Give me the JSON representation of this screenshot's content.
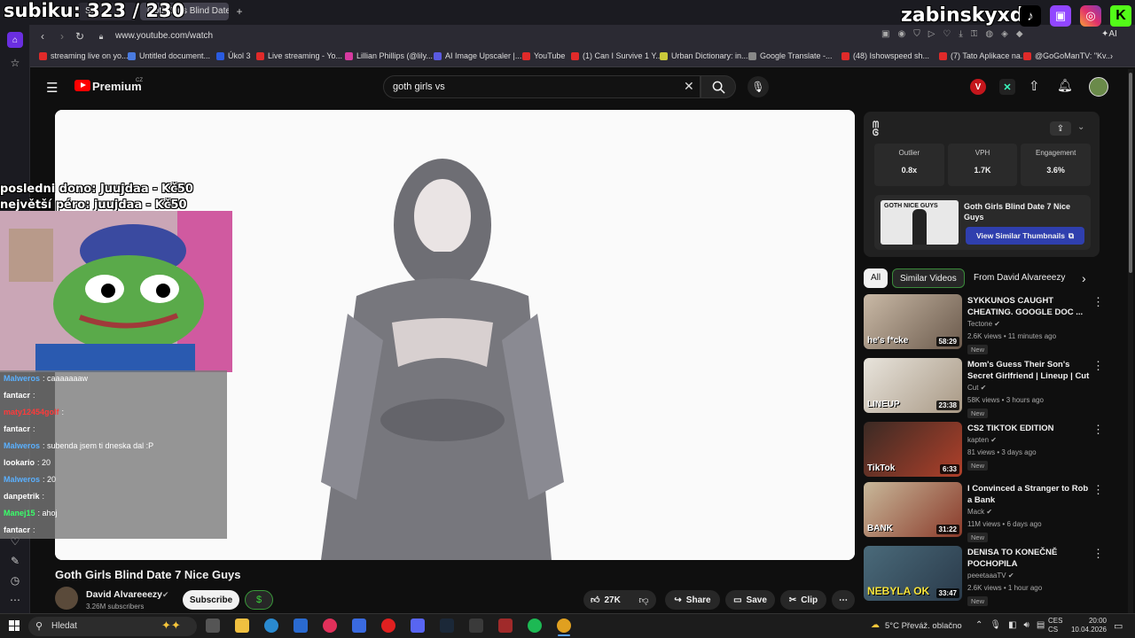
{
  "browser": {
    "tabs": [
      "S...",
      "Goth Girls Blind Date 7 N..."
    ],
    "url": "www.youtube.com/watch",
    "bookmarks": [
      {
        "label": "streaming live on yo...",
        "color": "#e02a2a"
      },
      {
        "label": "Untitled document...",
        "color": "#4a7be0"
      },
      {
        "label": "Úkol 3",
        "color": "#2a5be0"
      },
      {
        "label": "Live streaming - Yo...",
        "color": "#e02a2a"
      },
      {
        "label": "Lillian Phillips (@lily...",
        "color": "#d63aa0"
      },
      {
        "label": "AI Image Upscaler |...",
        "color": "#5a5ae0"
      },
      {
        "label": "YouTube",
        "color": "#e02a2a"
      },
      {
        "label": "(1) Can I Survive 1 Y...",
        "color": "#e02a2a"
      },
      {
        "label": "Urban Dictionary: in...",
        "color": "#caca3a"
      },
      {
        "label": "Google Translate -...",
        "color": "#888"
      },
      {
        "label": "(48) Ishowspeed sh...",
        "color": "#e02a2a"
      },
      {
        "label": "(7) Tato Aplikace na...",
        "color": "#e02a2a"
      },
      {
        "label": "@GoGoManTV: \"Kv...",
        "color": "#e02a2a"
      }
    ],
    "ai_label": "AI"
  },
  "youtube": {
    "logo_text": "Premium",
    "logo_region": "CZ",
    "search_value": "goth girls vs",
    "video_title": "Goth Girls Blind Date 7 Nice Guys",
    "channel_name": "David Alvareeezy",
    "subscribers": "3.26M subscribers",
    "subscribe_label": "Subscribe",
    "likes": "27K",
    "share_label": "Share",
    "save_label": "Save",
    "clip_label": "Clip"
  },
  "analytics": {
    "outlier_label": "Outlier",
    "outlier_value": "0.8x",
    "vph_label": "VPH",
    "vph_value": "1.7K",
    "engagement_label": "Engagement",
    "engagement_value": "3.6%",
    "thumb_title": "Goth Girls Blind Date 7 Nice Guys",
    "thumb_text": "GOTH NICE GUYS",
    "similar_button": "View Similar Thumbnails"
  },
  "chips": [
    "All",
    "Similar Videos",
    "From David Alvareeezy"
  ],
  "recommendations": [
    {
      "title": "SYKKUNOS CAUGHT CHEATING. GOOGLE DOC ...",
      "channel": "Tectone",
      "meta": "2.6K views • 11 minutes ago",
      "duration": "58:29",
      "badge": "New",
      "thumb_caption": "he's f*cke",
      "colors": [
        "#c9b9a6",
        "#6b5a4c"
      ]
    },
    {
      "title": "Mom's Guess Their Son's Secret Girlfriend | Lineup | Cut",
      "channel": "Cut",
      "meta": "58K views • 3 hours ago",
      "duration": "23:38",
      "badge": "New",
      "thumb_caption": "LINEUP",
      "colors": [
        "#e8e4dc",
        "#a89884"
      ]
    },
    {
      "title": "CS2 TIKTOK EDITION",
      "channel": "kapten",
      "meta": "81 views • 3 days ago",
      "duration": "6:33",
      "badge": "New",
      "thumb_caption": "TikTok",
      "colors": [
        "#3a2a24",
        "#b0402a"
      ]
    },
    {
      "title": "I Convinced a Stranger to Rob a Bank",
      "channel": "Mack",
      "meta": "11M views • 6 days ago",
      "duration": "31:22",
      "badge": "New",
      "thumb_caption": "BANK",
      "colors": [
        "#c8b89a",
        "#8a3a2a"
      ]
    },
    {
      "title": "DENISA TO KONEČNĚ POCHOPILA",
      "channel": "peeetaaaTV",
      "meta": "2.6K views • 1 hour ago",
      "duration": "33:47",
      "badge": "New",
      "thumb_caption": "NEBYLA OK",
      "colors": [
        "#4a6a7a",
        "#2a3a4a"
      ]
    }
  ],
  "overlay": {
    "sub_goal": "subiku: 323 / 230",
    "streamer": "zabinskyxd",
    "last_donation": "posledni dono: Juujdaa - Kč50",
    "top_donation": "největší péro: juujdaa - Kč50",
    "chat": [
      {
        "user": "Malweros",
        "msg": ": caaaaaaaw",
        "color": "#5ab0ff"
      },
      {
        "user": "fantacr",
        "msg": ":",
        "color": "#ffffff"
      },
      {
        "user": "maty12454golf",
        "msg": ":",
        "color": "#ff3a3a"
      },
      {
        "user": "fantacr",
        "msg": ":",
        "color": "#ffffff"
      },
      {
        "user": "Malweros",
        "msg": ": subenda jsem ti dneska dal :P",
        "color": "#5ab0ff"
      },
      {
        "user": "lookario",
        "msg": ": 20",
        "color": "#ffffff"
      },
      {
        "user": "Malweros",
        "msg": ": 20",
        "color": "#5ab0ff"
      },
      {
        "user": "danpetrik",
        "msg": ":",
        "color": "#ffffff"
      },
      {
        "user": "Manej15",
        "msg": ": ahoj",
        "color": "#3aff6a"
      },
      {
        "user": "fantacr",
        "msg": ":",
        "color": "#ffffff"
      }
    ]
  },
  "taskbar": {
    "search_label": "Hledat",
    "weather": "5°C  Převáž. oblačno",
    "lang": "CES",
    "lang2": "CS",
    "time": "20:00",
    "date": "10.04.2026"
  }
}
